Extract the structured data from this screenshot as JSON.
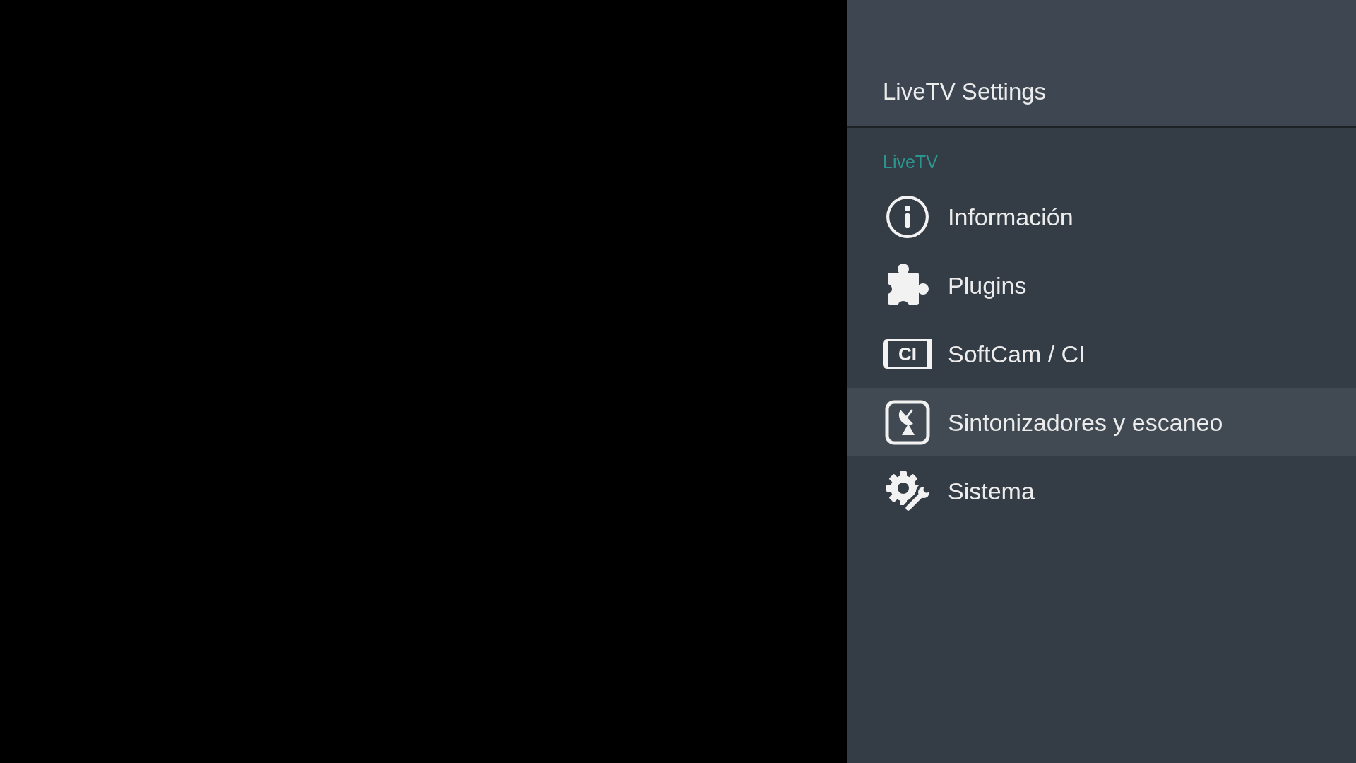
{
  "panel": {
    "title": "LiveTV Settings",
    "section": "LiveTV",
    "items": [
      {
        "label": "Información",
        "selected": false
      },
      {
        "label": "Plugins",
        "selected": false
      },
      {
        "label": "SoftCam / CI",
        "badge": "CI",
        "selected": false
      },
      {
        "label": "Sintonizadores y escaneo",
        "selected": true
      },
      {
        "label": "Sistema",
        "selected": false
      }
    ]
  }
}
